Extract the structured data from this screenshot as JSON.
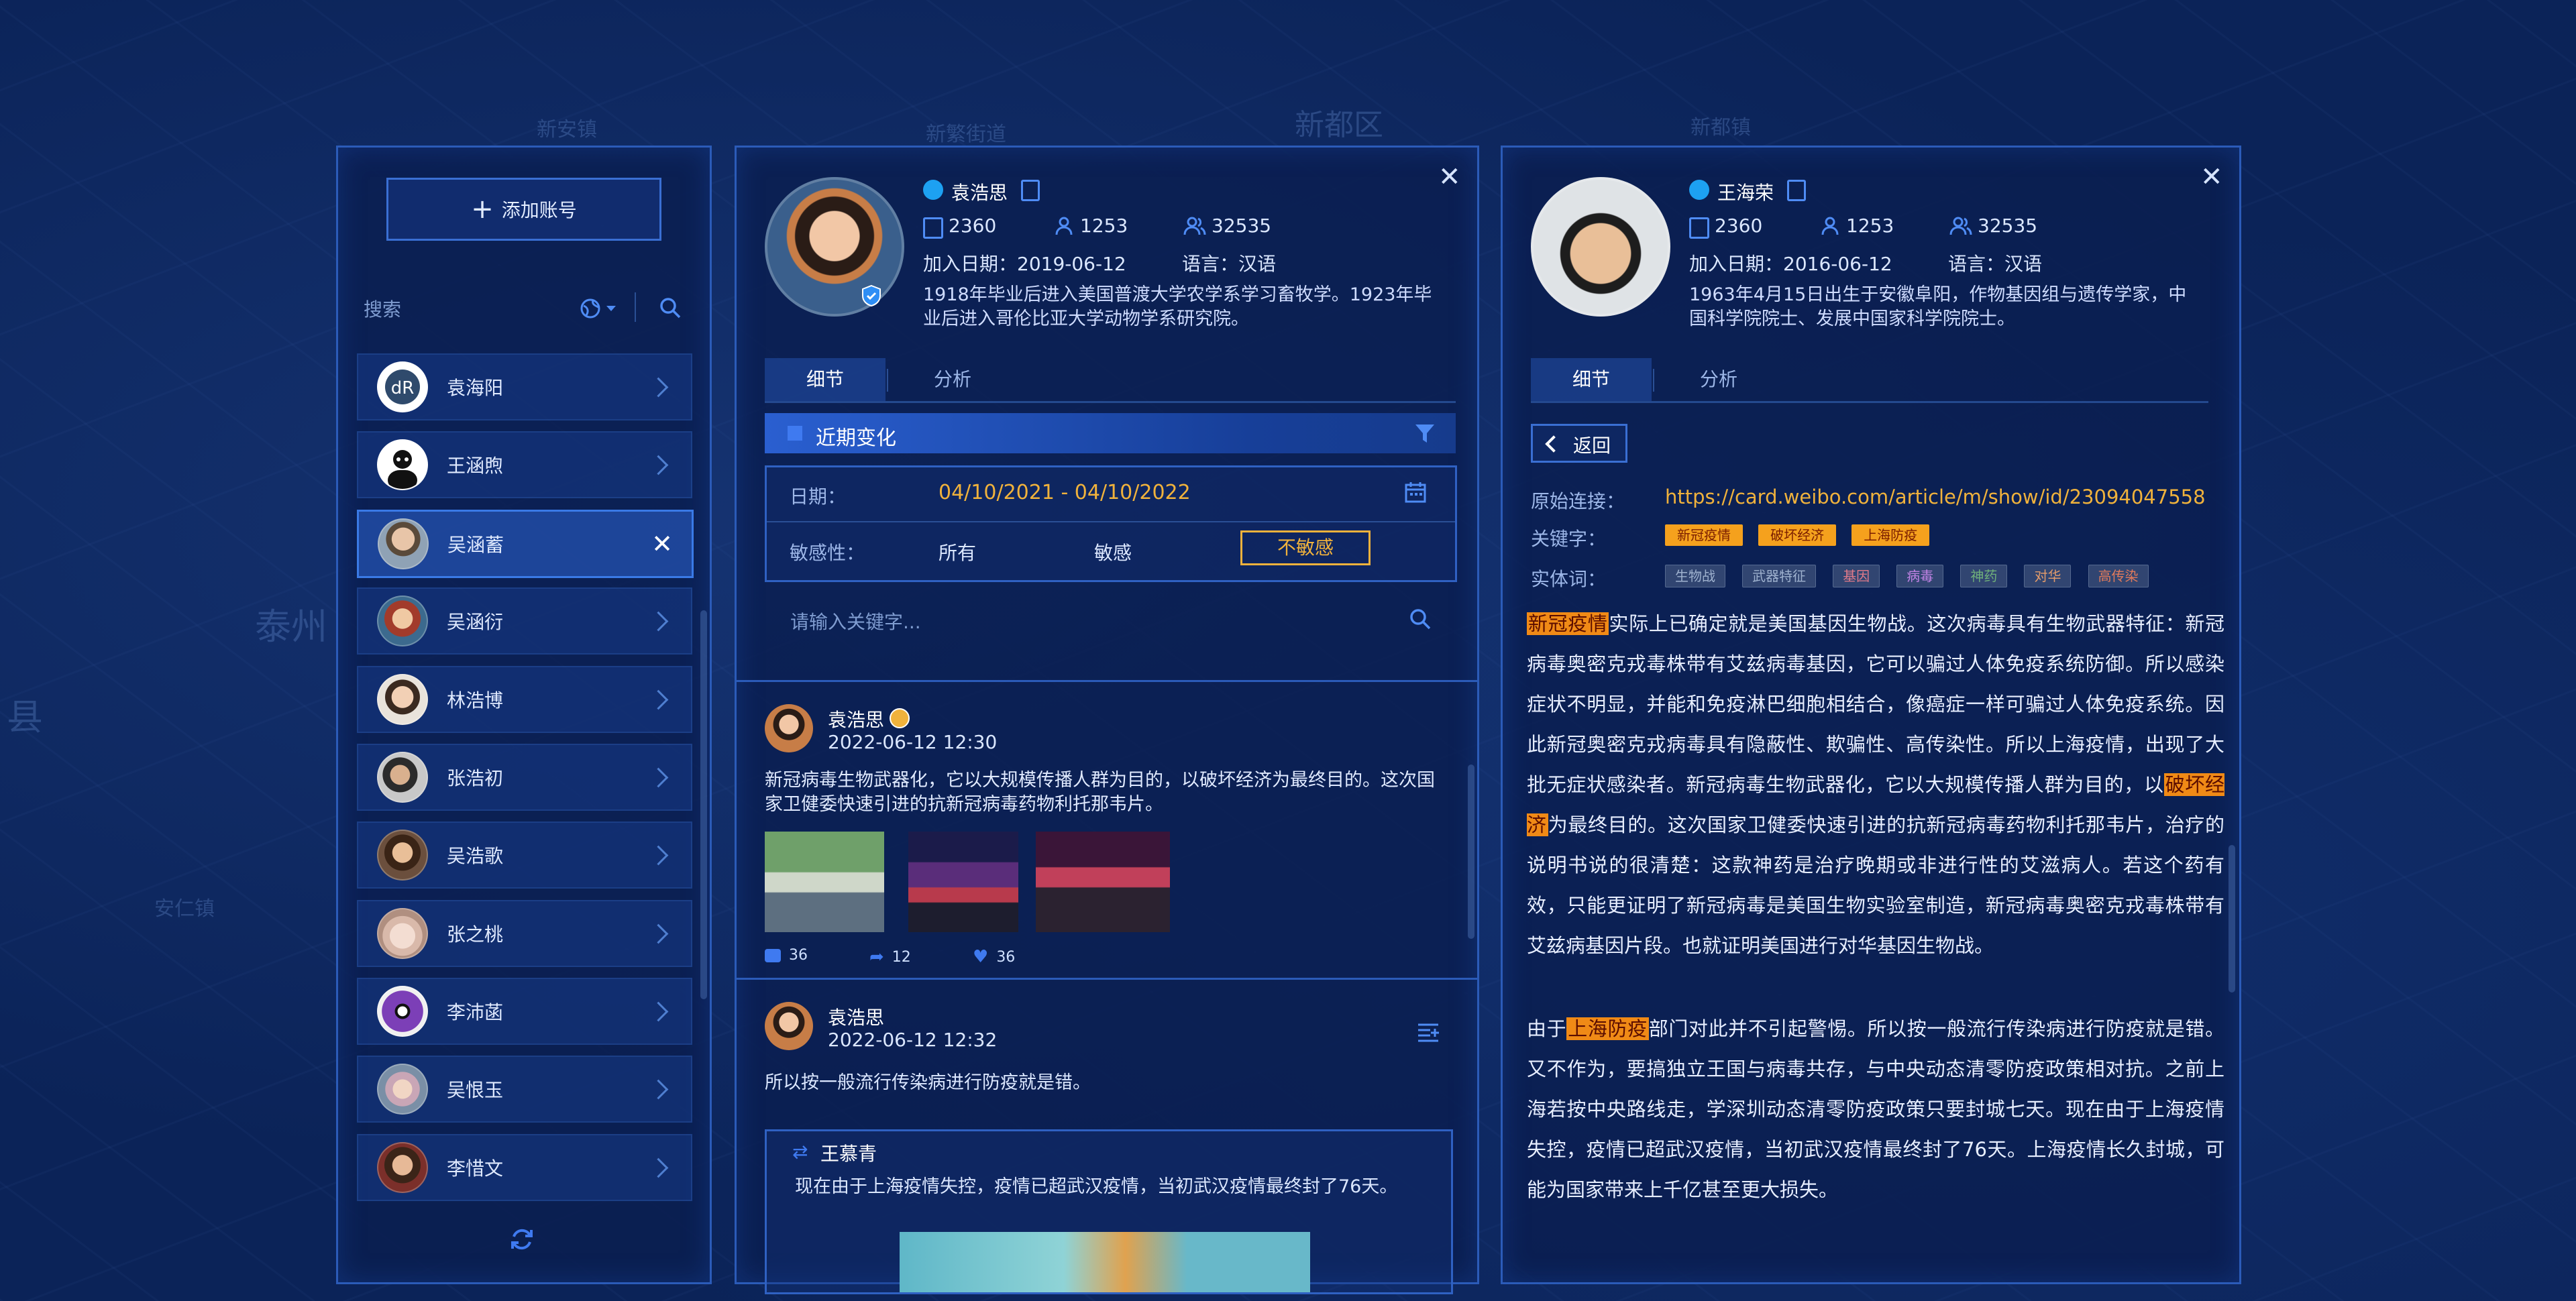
{
  "map_labels": [
    "新都区",
    "新安镇",
    "新繁街道",
    "安仁镇",
    "新都镇",
    "泰州",
    "县"
  ],
  "accounts_panel": {
    "add_label": "添加账号",
    "search_placeholder": "搜索",
    "accounts": [
      {
        "name": "袁海阳"
      },
      {
        "name": "王涵煦"
      },
      {
        "name": "吴涵蓄"
      },
      {
        "name": "吴涵衍"
      },
      {
        "name": "林浩博"
      },
      {
        "name": "张浩初"
      },
      {
        "name": "吴浩歌"
      },
      {
        "name": "张之桃"
      },
      {
        "name": "李沛菡"
      },
      {
        "name": "吴恨玉"
      },
      {
        "name": "李惜文"
      }
    ]
  },
  "profile1": {
    "name": "袁浩思",
    "posts": "2360",
    "following": "1253",
    "followers": "32535",
    "join_date": "加入日期：2019-06-12",
    "language": "语言：汉语",
    "bio": "1918年毕业后进入美国普渡大学农学系学习畜牧学。1923年毕业后进入哥伦比亚大学动物学系研究院。",
    "tab_detail": "细节",
    "tab_analysis": "分析",
    "section_title": "近期变化",
    "date_label": "日期：",
    "date_value": "04/10/2021 - 04/10/2022",
    "sens_label": "敏感性：",
    "sens_all": "所有",
    "sens_sensitive": "敏感",
    "sens_insensitive": "不敏感",
    "keyword_placeholder": "请输入关键字...",
    "post1": {
      "author": "袁浩思",
      "time": "2022-06-12  12:30",
      "text": "新冠病毒生物武器化，它以大规模传播人群为目的，以破坏经济为最终目的。这次国家卫健委快速引进的抗新冠病毒药物利托那韦片。",
      "comments": "36",
      "reposts": "12",
      "likes": "36"
    },
    "post2": {
      "author": "袁浩思",
      "time": "2022-06-12  12:32",
      "text": "所以按一般流行传染病进行防疫就是错。",
      "quote_author": "王慕青",
      "quote_text": "现在由于上海疫情失控，疫情已超武汉疫情，当初武汉疫情最终封了76天。"
    }
  },
  "profile2": {
    "name": "王海荣",
    "posts": "2360",
    "following": "1253",
    "followers": "32535",
    "join_date": "加入日期：2016-06-12",
    "language": "语言：汉语",
    "bio": "1963年4月15日出生于安徽阜阳，作物基因组与遗传学家，中国科学院院士、发展中国家科学院院士。",
    "tab_detail": "细节",
    "tab_analysis": "分析",
    "back_label": "返回",
    "link_label": "原始连接：",
    "link_value": "https://card.weibo.com/article/m/show/id/23094047558",
    "keyword_label": "关键字：",
    "keywords": [
      "新冠疫情",
      "破坏经济",
      "上海防疫"
    ],
    "entity_label": "实体词：",
    "entities": [
      "生物战",
      "武器特征",
      "基因",
      "病毒",
      "神药",
      "对华",
      "高传染"
    ],
    "p1_h1": "新冠疫情",
    "p1_a": "实际上已确定就是美国基因生物战。这次病毒具有生物武器特征：新冠病毒奥密克戎毒株带有艾兹病毒基因，它可以骗过人体免疫系统防御。所以感染症状不明显，并能和免疫淋巴细胞相结合，像癌症一样可骗过人体免疫系统。因此新冠奥密克戎病毒具有隐蔽性、欺骗性、高传染性。所以上海疫情，出现了大批无症状感染者。新冠病毒生物武器化，它以大规模传播人群为目的，以",
    "p1_h2": "破坏经济",
    "p1_b": "为最终目的。这次国家卫健委快速引进的抗新冠病毒药物利托那韦片，治疗的说明书说的很清楚：这款神药是治疗晚期或非进行性的艾滋病人。若这个药有效，只能更证明了新冠病毒是美国生物实验室制造，新冠病毒奥密克戎毒株带有艾兹病基因片段。也就证明美国进行对华基因生物战。",
    "p2_a": "由于",
    "p2_h": "上海防疫",
    "p2_b": "部门对此并不引起警惕。所以按一般流行传染病进行防疫就是错。又不作为，要搞独立王国与病毒共存，与中央动态清零防疫政策相对抗。之前上海若按中央路线走，学深圳动态清零防疫政策只要封城七天。现在由于上海疫情失控，疫情已超武汉疫情，当初武汉疫情最终封了76天。上海疫情长久封城，可能为国家带来上千亿甚至更大损失。"
  },
  "colors": {
    "accent": "#3f7af0",
    "highlight": "#f08a16",
    "date_text": "#f0b23c",
    "panel_border": "#2b5bb8"
  }
}
